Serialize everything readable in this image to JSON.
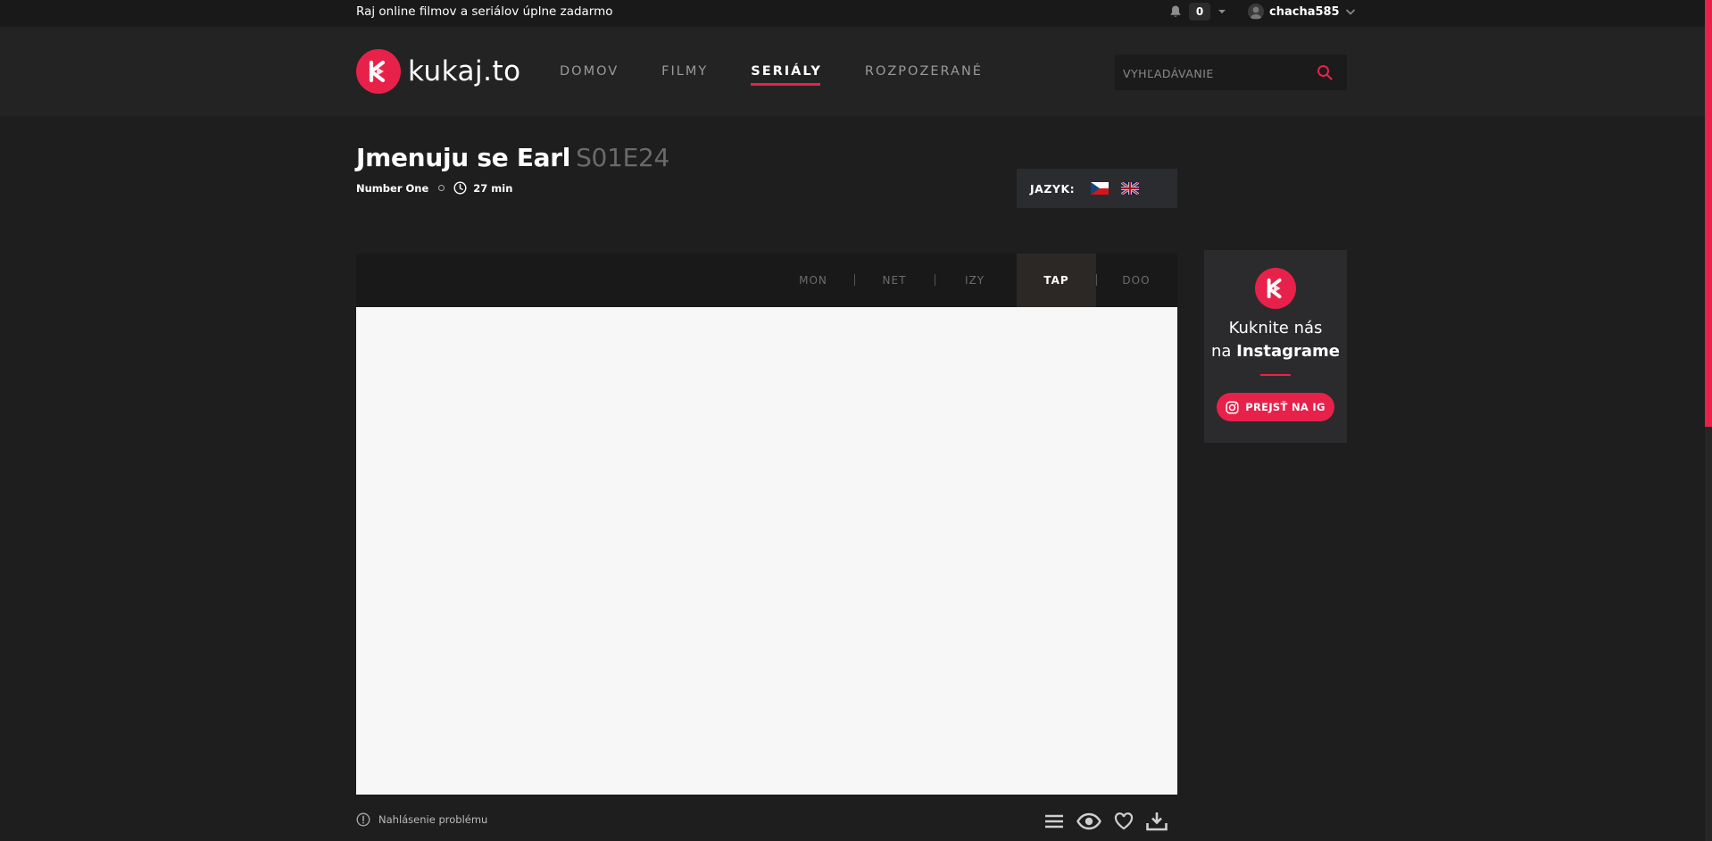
{
  "topbar": {
    "tagline": "Raj online filmov a seriálov úplne zadarmo",
    "notification_count": "0",
    "username": "chacha585"
  },
  "header": {
    "logo_text": "kukaj.to",
    "nav": [
      "DOMOV",
      "FILMY",
      "SERIÁLY",
      "ROZPOZERANÉ"
    ],
    "active_nav": "SERIÁLY",
    "search_placeholder": "VYHĽADÁVANIE"
  },
  "episode": {
    "title": "Jmenuju se Earl",
    "code": "S01E24",
    "name": "Number One",
    "duration": "27 min"
  },
  "language": {
    "label": "JAZYK:",
    "flags": [
      "czech-flag-icon",
      "uk-flag-icon"
    ]
  },
  "sources": {
    "items": [
      "MON",
      "NET",
      "IZY",
      "TAP",
      "DOO"
    ],
    "active": "TAP"
  },
  "footer": {
    "report_label": "Nahlásenie problému",
    "tools": [
      "list-icon",
      "eye-icon",
      "heart-icon",
      "download-icon"
    ]
  },
  "instagram": {
    "line1": "Kuknite nás",
    "line2_prefix": "na",
    "line2_bold": "Instagrame",
    "button": "PREJSŤ NA IG"
  },
  "colors": {
    "accent": "#e8214a",
    "background": "#1e1e1e",
    "header": "#232323"
  }
}
